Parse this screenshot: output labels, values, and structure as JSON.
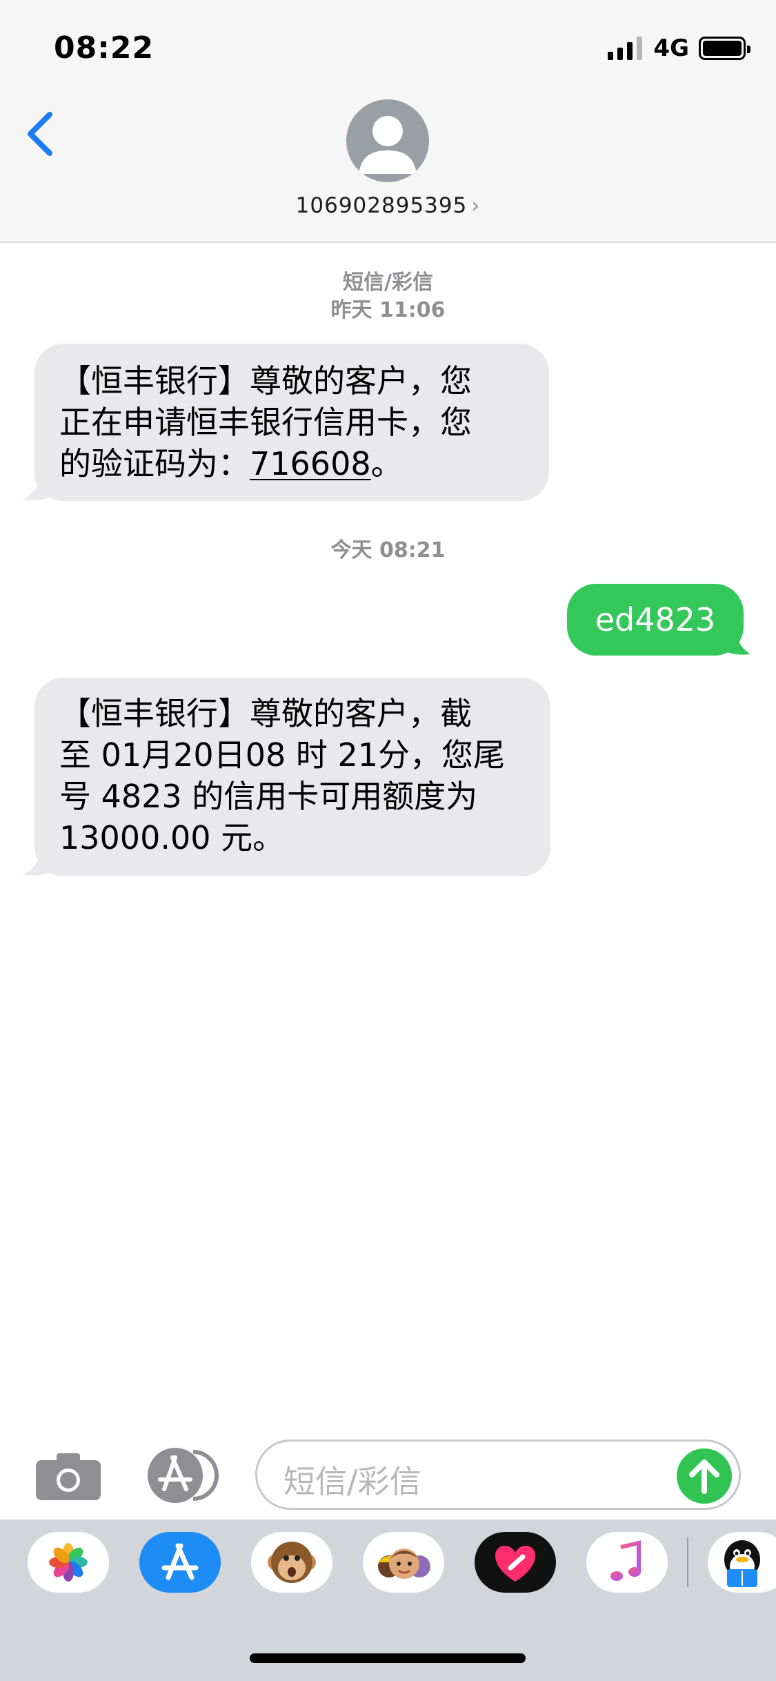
{
  "status_bar": {
    "time": "08:22",
    "network": "4G",
    "battery_fraction": 1.0
  },
  "header": {
    "contact": "106902895395",
    "contact_chevron": "›",
    "back_icon": "chevron-left-icon",
    "avatar_icon": "person-icon"
  },
  "conversation": {
    "timestamp_1_line1": "短信/彩信",
    "timestamp_1_line2": "昨天 11:06",
    "message_1": {
      "line1": "【恒丰银行】尊敬的客户，您",
      "line2": "正在申请恒丰银行信用卡，您",
      "line3_prefix": "的验证码为：",
      "code": "716608",
      "line3_suffix": "。"
    },
    "timestamp_2": "今天 08:21",
    "message_2": "ed4823",
    "message_3": {
      "line1": "【恒丰银行】尊敬的客户，截",
      "line2": "至 01月20日08 时 21分，您尾",
      "line3": "号 4823 的信用卡可用额度为",
      "line4": "13000.00 元。"
    }
  },
  "composer": {
    "placeholder": "短信/彩信",
    "camera_icon": "camera-icon",
    "apps_icon": "app-store-icon",
    "send_icon": "arrow-up-icon"
  },
  "app_drawer": {
    "apps": [
      "photos-icon",
      "app-store-icon",
      "animoji-monkey-icon",
      "memoji-icon",
      "digital-touch-heart-icon",
      "music-note-icon",
      "qq-penguin-icon"
    ]
  },
  "colors": {
    "incoming_bubble": "#e9e9eb",
    "outgoing_bubble": "#34c759",
    "accent_blue": "#1c7cf4",
    "send_green": "#31c453"
  }
}
